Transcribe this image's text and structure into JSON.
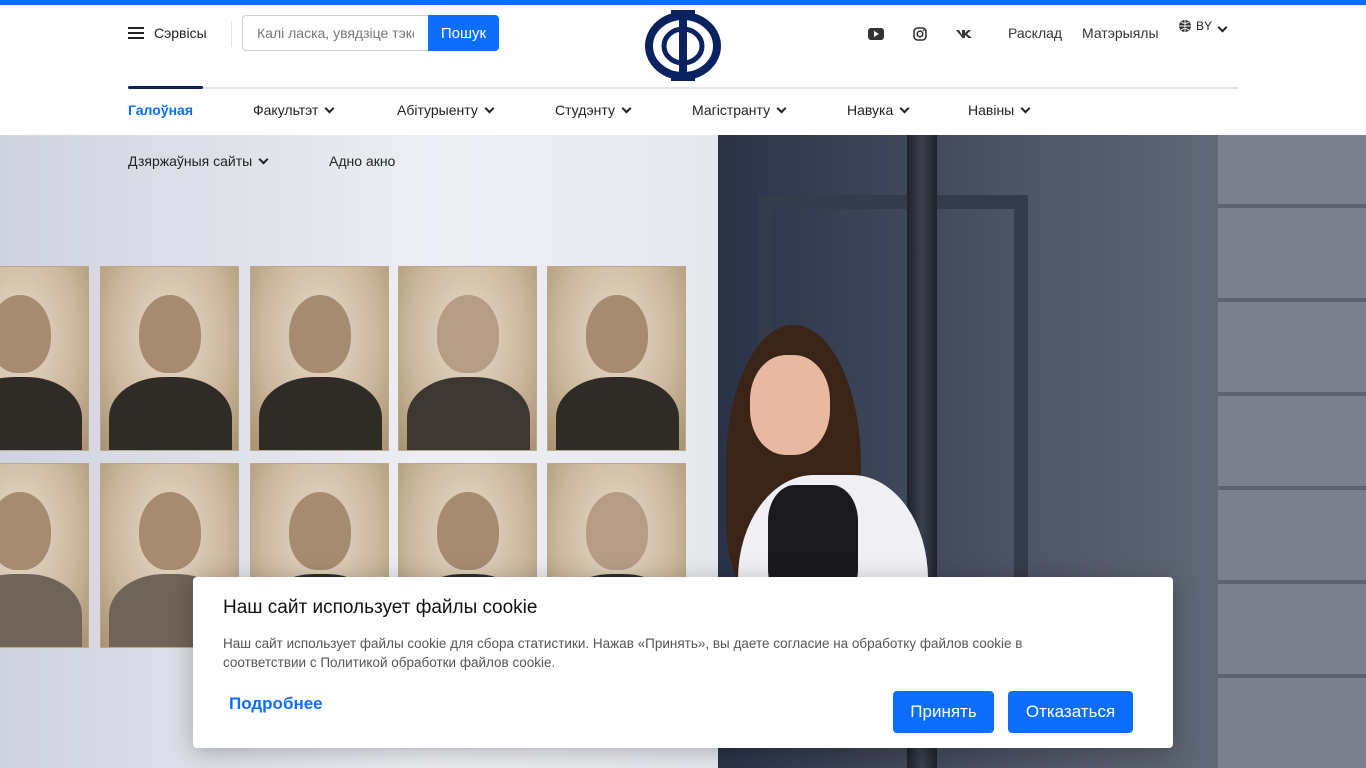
{
  "colors": {
    "accent": "#0d6efd",
    "navy": "#0b2260"
  },
  "header": {
    "services_label": "Сэрвісы",
    "search": {
      "placeholder": "Калі ласка, увядзіце тэкст",
      "button": "Пошук"
    },
    "socials": [
      "youtube-icon",
      "instagram-icon",
      "vk-icon"
    ],
    "links": {
      "schedule": "Расклад",
      "materials": "Матэрыялы"
    },
    "lang": "BY"
  },
  "nav": {
    "items": [
      {
        "label": "Галоўная"
      },
      {
        "label": "Факультэт"
      },
      {
        "label": "Абітурыенту"
      },
      {
        "label": "Студэнту"
      },
      {
        "label": "Магістранту"
      },
      {
        "label": "Навука"
      },
      {
        "label": "Навіны"
      }
    ]
  },
  "sub_nav": {
    "gov_sites": "Дзяржаўныя сайты",
    "one_window": "Адно акно"
  },
  "cookie": {
    "title": "Наш сайт использует файлы cookie",
    "text": "Наш сайт использует файлы cookie для сбора статистики. Нажав «Принять», вы даете согласие на обработку файлов cookie в соответствии с Политикой обработки файлов cookie.",
    "more": "Подробнее",
    "accept": "Принять",
    "decline": "Отказаться"
  }
}
